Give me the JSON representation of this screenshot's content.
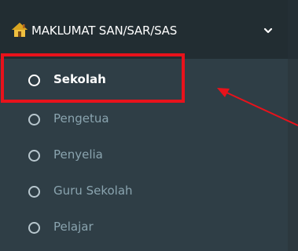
{
  "sidebar": {
    "header": {
      "label": "MAKLUMAT SAN/SAR/SAS",
      "icon": "home-icon",
      "chevron_icon": "chevron-down-icon"
    },
    "items": [
      {
        "label": "Sekolah",
        "icon": "circle-outline-icon",
        "active": true
      },
      {
        "label": "Pengetua",
        "icon": "circle-outline-icon",
        "active": false
      },
      {
        "label": "Penyelia",
        "icon": "circle-outline-icon",
        "active": false
      },
      {
        "label": "Guru Sekolah",
        "icon": "circle-outline-icon",
        "active": false
      },
      {
        "label": "Pelajar",
        "icon": "circle-outline-icon",
        "active": false
      }
    ]
  },
  "annotation": {
    "highlight_target": "sidebar-item-sekolah",
    "color": "#e8121b"
  },
  "colors": {
    "sidebar_bg": "#2f3e46",
    "header_bg": "#222d32",
    "active_text": "#ffffff",
    "inactive_text": "#8aa4af",
    "annotation_red": "#e8121b"
  }
}
